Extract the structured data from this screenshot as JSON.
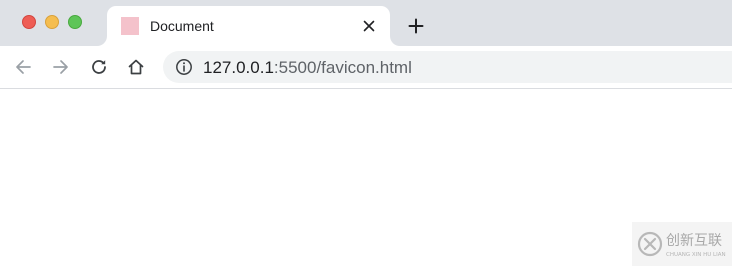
{
  "window": {
    "controls": [
      "close",
      "minimize",
      "maximize"
    ]
  },
  "tab": {
    "title": "Document",
    "favicon_color": "#f4c2cb",
    "close_icon": "close-icon"
  },
  "new_tab": {
    "icon": "plus-icon"
  },
  "toolbar": {
    "back_icon": "arrow-left-icon",
    "forward_icon": "arrow-right-icon",
    "reload_icon": "reload-icon",
    "home_icon": "home-icon"
  },
  "omnibox": {
    "info_icon": "info-icon",
    "url_host": "127.0.0.1",
    "url_path": ":5500/favicon.html"
  },
  "watermark": {
    "brand": "创新互联",
    "subtext": "CHUANG XIN HU LIAN"
  }
}
